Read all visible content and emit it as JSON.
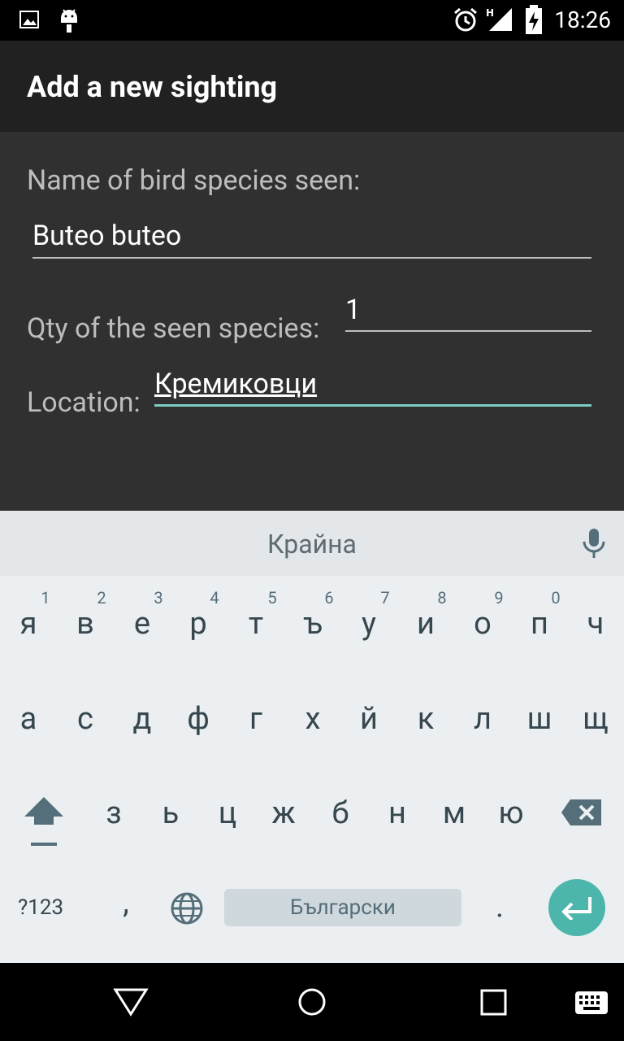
{
  "status": {
    "time": "18:26"
  },
  "app": {
    "title": "Add a new sighting"
  },
  "form": {
    "species_label": "Name of bird species seen:",
    "species_value": "Buteo buteo",
    "qty_label": "Qty of the seen species:",
    "qty_value": "1",
    "location_label": "Location:",
    "location_value": "Кремиковци"
  },
  "keyboard": {
    "suggestion": "Крайна",
    "row1_hints": [
      "1",
      "2",
      "3",
      "4",
      "5",
      "6",
      "7",
      "8",
      "9",
      "0"
    ],
    "row1": [
      "я",
      "в",
      "е",
      "р",
      "т",
      "ъ",
      "у",
      "и",
      "о",
      "п",
      "ч"
    ],
    "row2": [
      "а",
      "с",
      "д",
      "ф",
      "г",
      "х",
      "й",
      "к",
      "л",
      "ш",
      "щ"
    ],
    "row3": [
      "з",
      "ь",
      "ц",
      "ж",
      "б",
      "н",
      "м",
      "ю"
    ],
    "symbols": "?123",
    "comma": ",",
    "space_label": "Български",
    "period": "."
  },
  "colors": {
    "accent": "#80cbc4",
    "enter": "#4db6ac"
  }
}
